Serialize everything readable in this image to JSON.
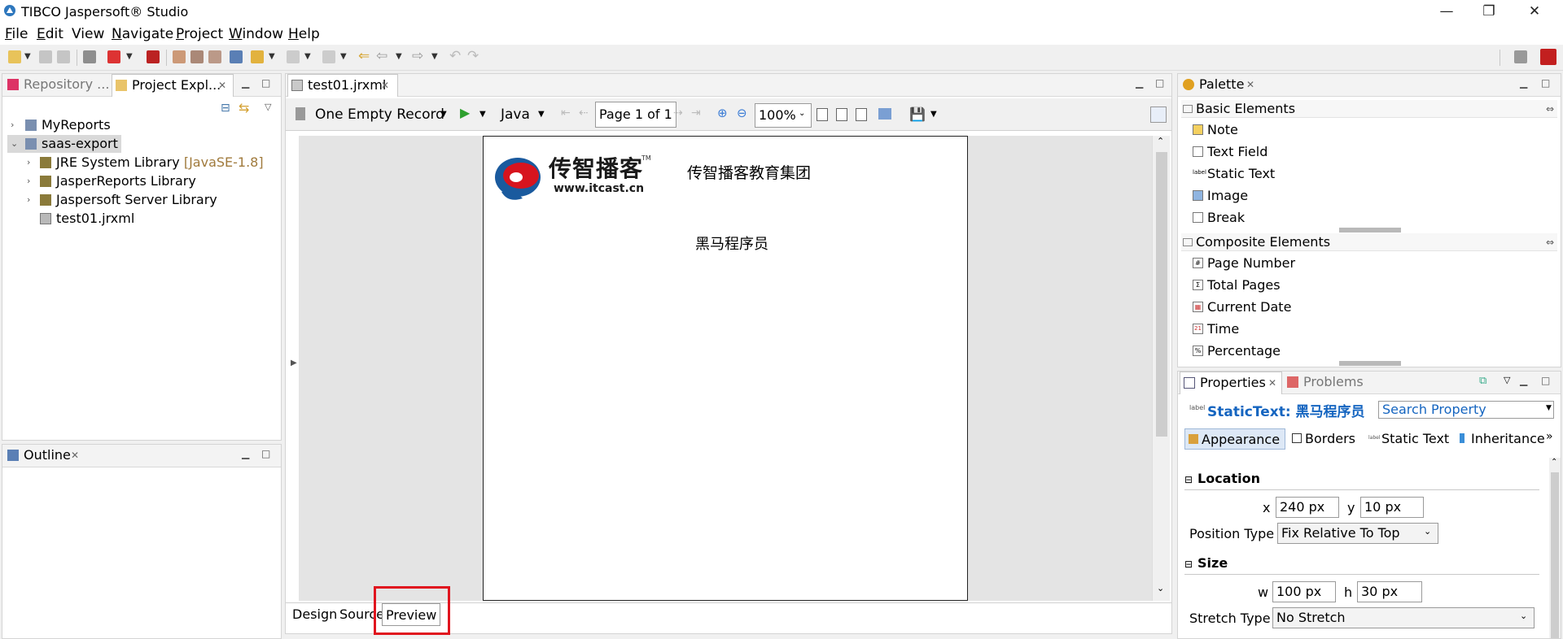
{
  "window": {
    "title": "TIBCO Jaspersoft® Studio",
    "controls": {
      "minimize": "—",
      "restore": "❐",
      "close": "✕"
    }
  },
  "menu": [
    {
      "label": "File",
      "mnemonic": "F",
      "rest": "ile"
    },
    {
      "label": "Edit",
      "mnemonic": "E",
      "rest": "dit"
    },
    {
      "label": "View",
      "mnemonic": "",
      "rest": "View"
    },
    {
      "label": "Navigate",
      "mnemonic": "N",
      "rest": "avigate"
    },
    {
      "label": "Project",
      "mnemonic": "P",
      "rest": "roject"
    },
    {
      "label": "Window",
      "mnemonic": "W",
      "rest": "indow"
    },
    {
      "label": "Help",
      "mnemonic": "H",
      "rest": "elp"
    }
  ],
  "left_panel": {
    "tabs": [
      {
        "label": "Repository ...",
        "state": "inactive"
      },
      {
        "label": "Project Expl...",
        "state": "active",
        "close": "✕"
      }
    ],
    "tree": [
      {
        "label": "MyReports",
        "twisty": "›",
        "icon": "project-icon"
      },
      {
        "label": "saas-export",
        "twisty": "⌄",
        "icon": "project-icon",
        "selected": true
      },
      {
        "label": "JRE System Library",
        "hint": "[JavaSE-1.8]",
        "twisty": "›",
        "icon": "library-icon"
      },
      {
        "label": "JasperReports Library",
        "twisty": "›",
        "icon": "library-icon"
      },
      {
        "label": "Jaspersoft Server Library",
        "twisty": "›",
        "icon": "library-icon"
      },
      {
        "label": "test01.jrxml",
        "icon": "jrxml-file-icon"
      }
    ]
  },
  "outline_panel": {
    "title": "Outline",
    "close": "✕"
  },
  "editor": {
    "tab_label": "test01.jrxml",
    "close": "✕",
    "toolbar": {
      "data_adapter": "One Empty Record",
      "language": "Java",
      "page_indicator": "Page 1 of 1",
      "zoom": "100%"
    },
    "report": {
      "logo_text": "传智播客",
      "logo_tm": "TM",
      "logo_url": "www.itcast.cn",
      "header_text": "传智播客教育集团",
      "static_text": "黑马程序员"
    },
    "bottom_tabs": [
      {
        "label": "Design"
      },
      {
        "label": "Source"
      },
      {
        "label": "Preview",
        "active": true,
        "highlighted": true
      }
    ],
    "colors": {
      "highlight": "#e0141e",
      "logo_red": "#d7141e",
      "logo_blue": "#1a5a9e"
    }
  },
  "palette": {
    "title": "Palette",
    "close": "✕",
    "sections": [
      {
        "label": "Basic Elements",
        "items": [
          {
            "label": "Note",
            "icon": "note-icon"
          },
          {
            "label": "Text Field",
            "icon": "text-field-icon"
          },
          {
            "label": "Static Text",
            "icon": "static-text-icon"
          },
          {
            "label": "Image",
            "icon": "image-icon"
          },
          {
            "label": "Break",
            "icon": "break-icon"
          }
        ]
      },
      {
        "label": "Composite Elements",
        "items": [
          {
            "label": "Page Number",
            "icon": "page-number-icon",
            "glyph": "#"
          },
          {
            "label": "Total Pages",
            "icon": "total-pages-icon",
            "glyph": "Σ"
          },
          {
            "label": "Current Date",
            "icon": "calendar-icon",
            "glyph": "▦"
          },
          {
            "label": "Time",
            "icon": "time-icon",
            "glyph": "21"
          },
          {
            "label": "Percentage",
            "icon": "percentage-icon",
            "glyph": "%"
          }
        ]
      }
    ]
  },
  "properties": {
    "tabs": [
      {
        "label": "Properties",
        "state": "active",
        "close": "✕"
      },
      {
        "label": "Problems",
        "state": "inactive"
      }
    ],
    "element_title": "StaticText: 黑马程序员",
    "search_placeholder": "Search Property",
    "sheet_tabs": [
      {
        "label": "Appearance",
        "active": true
      },
      {
        "label": "Borders"
      },
      {
        "label": "Static Text"
      },
      {
        "label": "Inheritance"
      }
    ],
    "location": {
      "heading": "Location",
      "x_label": "x",
      "x_value": "240 px",
      "y_label": "y",
      "y_value": "10 px",
      "position_type_label": "Position Type",
      "position_type_value": "Fix Relative To Top"
    },
    "size": {
      "heading": "Size",
      "w_label": "w",
      "w_value": "100 px",
      "h_label": "h",
      "h_value": "30 px",
      "stretch_type_label": "Stretch Type",
      "stretch_type_value": "No Stretch"
    },
    "section_toggle": "⊟"
  }
}
